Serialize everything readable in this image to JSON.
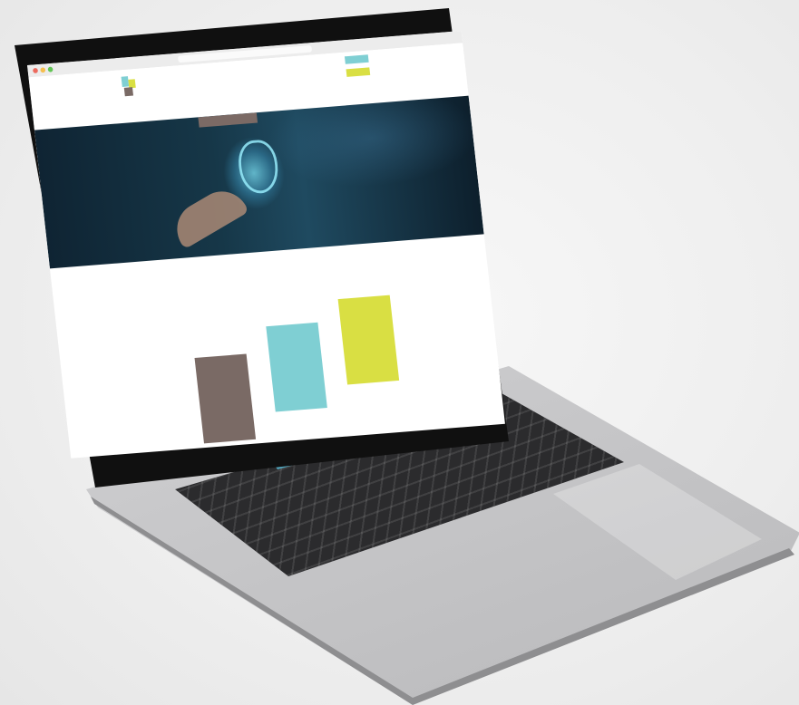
{
  "browser": {
    "window_controls": [
      "close",
      "minimize",
      "maximize"
    ]
  },
  "site": {
    "name": "",
    "header_buttons": [
      {
        "label": ""
      },
      {
        "label": ""
      }
    ],
    "nav": []
  },
  "hero": {
    "label": "",
    "image": "cybersecurity-shield-hand"
  },
  "tagline": "",
  "cards": [
    {
      "color": "#7a6a65",
      "text": "",
      "value": ""
    },
    {
      "color": "#7fcfd3",
      "text": "",
      "value": ""
    },
    {
      "color": "#d9df43",
      "text": "",
      "value": ""
    }
  ],
  "device": {
    "type": "laptop",
    "touchbar_accent": "#56b6d1"
  },
  "colors": {
    "brown": "#7a6a65",
    "teal": "#7fcfd3",
    "lime": "#d9df43",
    "hero_dark": "#0f2433"
  }
}
